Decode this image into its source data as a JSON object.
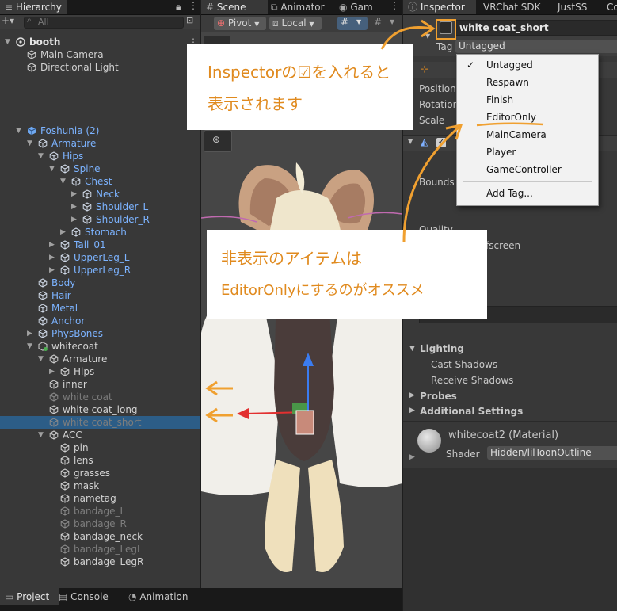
{
  "hierarchy": {
    "tab_label": "Hierarchy",
    "search_placeholder": "All",
    "rows": [
      {
        "label": "booth",
        "style": "head",
        "indent": 0,
        "arrow": "▼",
        "icon": "unity"
      },
      {
        "label": "Main Camera",
        "style": "normal",
        "indent": 1,
        "arrow": "",
        "icon": "cube"
      },
      {
        "label": "Directional Light",
        "style": "normal",
        "indent": 1,
        "arrow": "",
        "icon": "cube"
      },
      {
        "label": "Foshunia (2)",
        "style": "prefab",
        "indent": 1,
        "arrow": "▼",
        "icon": "prefab"
      },
      {
        "label": "Armature",
        "style": "prefab",
        "indent": 2,
        "arrow": "▼",
        "icon": "cube"
      },
      {
        "label": "Hips",
        "style": "prefab",
        "indent": 3,
        "arrow": "▼",
        "icon": "cube"
      },
      {
        "label": "Spine",
        "style": "prefab",
        "indent": 4,
        "arrow": "▼",
        "icon": "cube"
      },
      {
        "label": "Chest",
        "style": "prefab",
        "indent": 5,
        "arrow": "▼",
        "icon": "cube"
      },
      {
        "label": "Neck",
        "style": "prefab",
        "indent": 6,
        "arrow": "▶",
        "icon": "cube"
      },
      {
        "label": "Shoulder_L",
        "style": "prefab",
        "indent": 6,
        "arrow": "▶",
        "icon": "cube"
      },
      {
        "label": "Shoulder_R",
        "style": "prefab",
        "indent": 6,
        "arrow": "▶",
        "icon": "cube"
      },
      {
        "label": "Stomach",
        "style": "prefab",
        "indent": 5,
        "arrow": "▶",
        "icon": "cube"
      },
      {
        "label": "Tail_01",
        "style": "prefab",
        "indent": 4,
        "arrow": "▶",
        "icon": "cube"
      },
      {
        "label": "UpperLeg_L",
        "style": "prefab",
        "indent": 4,
        "arrow": "▶",
        "icon": "cube"
      },
      {
        "label": "UpperLeg_R",
        "style": "prefab",
        "indent": 4,
        "arrow": "▶",
        "icon": "cube"
      },
      {
        "label": "Body",
        "style": "prefab",
        "indent": 2,
        "arrow": "",
        "icon": "cube"
      },
      {
        "label": "Hair",
        "style": "prefab",
        "indent": 2,
        "arrow": "",
        "icon": "cube"
      },
      {
        "label": "Metal",
        "style": "prefab",
        "indent": 2,
        "arrow": "",
        "icon": "cube"
      },
      {
        "label": "Anchor",
        "style": "prefab",
        "indent": 2,
        "arrow": "",
        "icon": "cube"
      },
      {
        "label": "PhysBones",
        "style": "prefab",
        "indent": 2,
        "arrow": "▶",
        "icon": "cube"
      },
      {
        "label": "whitecoat",
        "style": "normal",
        "indent": 2,
        "arrow": "▼",
        "icon": "prefab-green"
      },
      {
        "label": "Armature",
        "style": "normal",
        "indent": 3,
        "arrow": "▼",
        "icon": "cube"
      },
      {
        "label": "Hips",
        "style": "normal",
        "indent": 4,
        "arrow": "▶",
        "icon": "cube"
      },
      {
        "label": "inner",
        "style": "normal",
        "indent": 3,
        "arrow": "",
        "icon": "cube"
      },
      {
        "label": "white coat",
        "style": "disabled",
        "indent": 3,
        "arrow": "",
        "icon": "cube"
      },
      {
        "label": "white coat_long",
        "style": "normal",
        "indent": 3,
        "arrow": "",
        "icon": "cube"
      },
      {
        "label": "white coat_short",
        "style": "disabled",
        "indent": 3,
        "arrow": "",
        "icon": "cube",
        "selected": true
      },
      {
        "label": "ACC",
        "style": "normal",
        "indent": 3,
        "arrow": "▼",
        "icon": "cube"
      },
      {
        "label": "pin",
        "style": "normal",
        "indent": 4,
        "arrow": "",
        "icon": "cube"
      },
      {
        "label": "lens",
        "style": "normal",
        "indent": 4,
        "arrow": "",
        "icon": "cube"
      },
      {
        "label": "grasses",
        "style": "normal",
        "indent": 4,
        "arrow": "",
        "icon": "cube"
      },
      {
        "label": "mask",
        "style": "normal",
        "indent": 4,
        "arrow": "",
        "icon": "cube"
      },
      {
        "label": "nametag",
        "style": "normal",
        "indent": 4,
        "arrow": "",
        "icon": "cube"
      },
      {
        "label": "bandage_L",
        "style": "disabled",
        "indent": 4,
        "arrow": "",
        "icon": "cube"
      },
      {
        "label": "bandage_R",
        "style": "disabled",
        "indent": 4,
        "arrow": "",
        "icon": "cube"
      },
      {
        "label": "bandage_neck",
        "style": "normal",
        "indent": 4,
        "arrow": "",
        "icon": "cube"
      },
      {
        "label": "bandage_LegL",
        "style": "disabled",
        "indent": 4,
        "arrow": "",
        "icon": "cube"
      },
      {
        "label": "bandage_LegR",
        "style": "normal",
        "indent": 4,
        "arrow": "",
        "icon": "cube"
      }
    ]
  },
  "scene": {
    "tabs": [
      "Scene",
      "Animator",
      "Gam"
    ],
    "pivot_label": "Pivot",
    "local_label": "Local"
  },
  "inspector": {
    "tabs": [
      "Inspector",
      "VRChat SDK",
      "JustSS",
      "Co"
    ],
    "object_name": "white coat_short",
    "tag_label": "Tag",
    "tag_value": "Untagged",
    "transform": {
      "position": "Position",
      "rotation": "Rotation",
      "scale": "Scale"
    },
    "renderer": {
      "bounds": "Bounds",
      "quality": "Quality",
      "offscreen": "ffscreen",
      "lighting": "Lighting",
      "cast_shadows": "Cast Shadows",
      "receive_shadows": "Receive Shadows",
      "probes": "Probes",
      "additional": "Additional Settings"
    },
    "material": {
      "name": "whitecoat2 (Material)",
      "shader_label": "Shader",
      "shader_value": "Hidden/lilToonOutline"
    }
  },
  "tag_menu": {
    "items": [
      "Untagged",
      "Respawn",
      "Finish",
      "EditorOnly",
      "MainCamera",
      "Player",
      "GameController"
    ],
    "checked_index": 0,
    "add_tag": "Add Tag..."
  },
  "notes": {
    "note1_line1": "Inspectorの☑を入れると",
    "note1_line2": "表示されます",
    "note2_line1": "非表示のアイテムは",
    "note2_line2": "EditorOnlyにするのがオススメ"
  },
  "bottom_tabs": [
    "Project",
    "Console",
    "Animation"
  ],
  "colors": {
    "annotation": "#e08a1e",
    "selection": "#2c5d87",
    "prefab_text": "#7cb3ff"
  }
}
